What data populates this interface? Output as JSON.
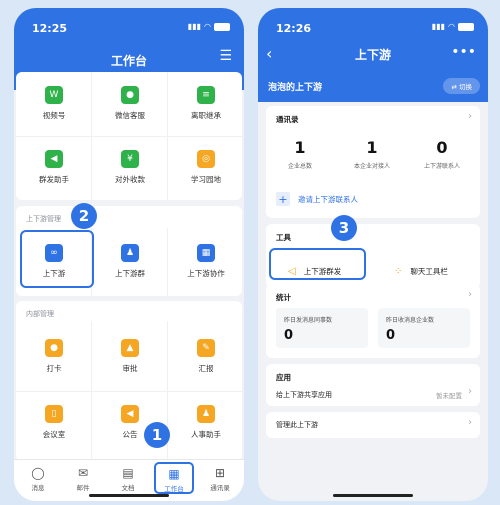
{
  "left": {
    "time": "12:25",
    "title": "工作台",
    "top_apps": [
      "视频号",
      "微信客服",
      "离职继承",
      "群发助手",
      "对外收款",
      "学习园地"
    ],
    "section_updown": "上下游管理",
    "updown_apps": [
      "上下游",
      "上下游群",
      "上下游协作"
    ],
    "section_internal": "内部管理",
    "internal_apps": [
      "打卡",
      "审批",
      "汇报",
      "会议室",
      "公告",
      "人事助手"
    ],
    "tabs": [
      "消息",
      "邮件",
      "文档",
      "工作台",
      "通讯录"
    ],
    "badges": [
      "1",
      "2"
    ]
  },
  "right": {
    "time": "12:26",
    "title": "上下游",
    "org_name": "泡泡的上下游",
    "switch_label": "切换",
    "contacts": {
      "title": "通讯录",
      "stats": [
        {
          "value": "1",
          "label": "企业总数"
        },
        {
          "value": "1",
          "label": "本企业对接人"
        },
        {
          "value": "0",
          "label": "上下游联系人"
        }
      ],
      "invite": "邀请上下游联系人"
    },
    "tools": {
      "title": "工具",
      "items": [
        "上下游群发",
        "聊天工具栏"
      ]
    },
    "stats": {
      "title": "统计",
      "boxes": [
        {
          "label": "昨日发消息同事数",
          "value": "0"
        },
        {
          "label": "昨日收消息企业数",
          "value": "0"
        }
      ]
    },
    "apps": {
      "title": "应用",
      "item": "给上下游共享应用",
      "status": "暂未配置"
    },
    "manage": "管理此上下游",
    "badge": "3"
  },
  "colors": {
    "accent": "#2f72e4",
    "green": "#2fb24a",
    "orange": "#f5a623"
  }
}
